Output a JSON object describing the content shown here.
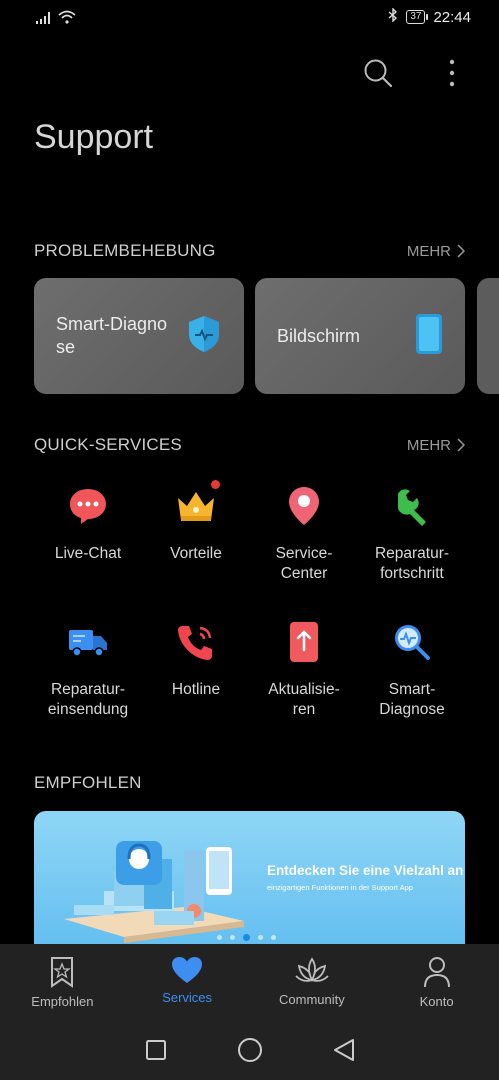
{
  "status": {
    "battery": "37",
    "time": "22:44"
  },
  "header": {
    "title": "Support"
  },
  "troubleshooting": {
    "title": "PROBLEMBEHEBUNG",
    "more": "MEHR",
    "cards": [
      {
        "label": "Smart-Diagnose",
        "icon": "shield-diagnose-icon"
      },
      {
        "label": "Bildschirm",
        "icon": "phone-screen-icon"
      }
    ]
  },
  "quick_services": {
    "title": "QUICK-SERVICES",
    "more": "MEHR",
    "items": [
      {
        "label": "Live-Chat",
        "icon": "chat-bubble-icon",
        "color": "#f0555a"
      },
      {
        "label": "Vorteile",
        "icon": "crown-icon",
        "color": "#f5b52e",
        "badge": true
      },
      {
        "label": "Service-\nCenter",
        "icon": "location-pin-icon",
        "color": "#f06575"
      },
      {
        "label": "Reparatur-\nfortschritt",
        "icon": "wrench-icon",
        "color": "#3ebd4c"
      },
      {
        "label": "Reparatur-\neinsendung",
        "icon": "truck-icon",
        "color": "#3a8ff0"
      },
      {
        "label": "Hotline",
        "icon": "phone-call-icon",
        "color": "#f0454f"
      },
      {
        "label": "Aktualisie-\nren",
        "icon": "update-icon",
        "color": "#f05a5f"
      },
      {
        "label": "Smart-\nDiagnose",
        "icon": "magnifier-pulse-icon",
        "color": "#3a8ff0"
      }
    ]
  },
  "recommended": {
    "title": "EMPFOHLEN",
    "banner_title": "Entdecken Sie eine Vielzahl an",
    "banner_sub": "einzigartigen Funktionen in der Support App",
    "active_slide": 3,
    "slide_count": 5
  },
  "tabs": [
    {
      "label": "Empfohlen",
      "icon": "bookmark-star-icon"
    },
    {
      "label": "Services",
      "icon": "heart-icon",
      "active": true
    },
    {
      "label": "Community",
      "icon": "lotus-icon"
    },
    {
      "label": "Konto",
      "icon": "person-icon"
    }
  ],
  "colors": {
    "accent": "#3d8ef0"
  }
}
